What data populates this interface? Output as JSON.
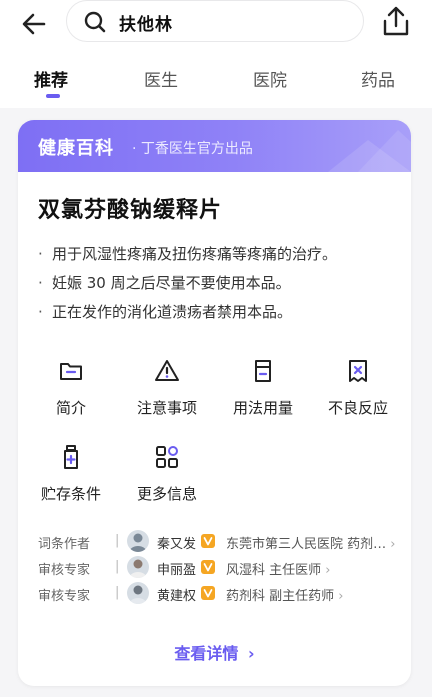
{
  "search": {
    "query": "扶他林"
  },
  "tabs": [
    {
      "label": "推荐"
    },
    {
      "label": "医生"
    },
    {
      "label": "医院"
    },
    {
      "label": "药品"
    }
  ],
  "card": {
    "brand": "健康百科",
    "subtitle": "· 丁香医生官方出品",
    "drug_name": "双氯芬酸钠缓释片",
    "bullets": [
      "用于风湿性疼痛及扭伤疼痛等疼痛的治疗。",
      "妊娠 30 周之后尽量不要使用本品。",
      "正在发作的消化道溃疡者禁用本品。"
    ],
    "features": [
      {
        "label": "简介",
        "icon": "folder-icon"
      },
      {
        "label": "注意事项",
        "icon": "warning-icon"
      },
      {
        "label": "用法用量",
        "icon": "dosage-icon"
      },
      {
        "label": "不良反应",
        "icon": "adverse-reaction-icon"
      },
      {
        "label": "贮存条件",
        "icon": "bottle-icon"
      },
      {
        "label": "更多信息",
        "icon": "more-grid-icon"
      }
    ],
    "people": [
      {
        "role": "词条作者",
        "name": "秦又发",
        "info": "东莞市第三人民医院 药剂…"
      },
      {
        "role": "审核专家",
        "name": "申丽盈",
        "info": "风湿科 主任医师"
      },
      {
        "role": "审核专家",
        "name": "黄建权",
        "info": "药剂科 副主任药师"
      }
    ],
    "verified_badge": "V",
    "more_link": "查看详情"
  },
  "colors": {
    "accent": "#6a5cf0",
    "badge": "#f5a623"
  }
}
